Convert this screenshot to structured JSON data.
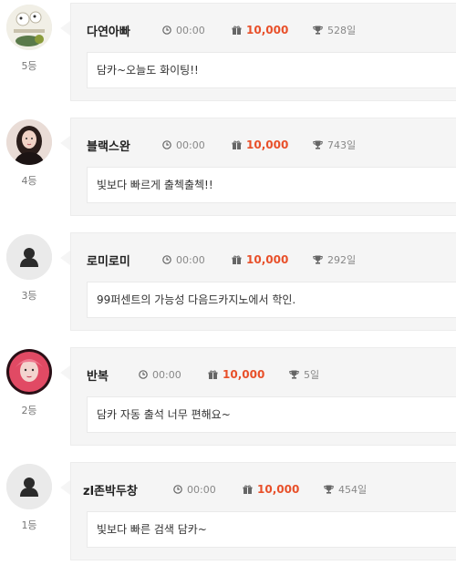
{
  "entries": [
    {
      "rank": "5등",
      "nickname": "다연아빠",
      "time": "00:00",
      "points": "10,000",
      "days": "528일",
      "message": "담카~오늘도 화이팅!!",
      "avatar_icon": "photo-avatar-icon"
    },
    {
      "rank": "4등",
      "nickname": "블랙스완",
      "time": "00:00",
      "points": "10,000",
      "days": "743일",
      "message": "빛보다 빠르게 출첵출첵!!",
      "avatar_icon": "photo-avatar-icon"
    },
    {
      "rank": "3등",
      "nickname": "로미로미",
      "time": "00:00",
      "points": "10,000",
      "days": "292일",
      "message": "99퍼센트의 가능성 다음드카지노에서 학인.",
      "avatar_icon": "default-user-icon"
    },
    {
      "rank": "2등",
      "nickname": "반복",
      "time": "00:00",
      "points": "10,000",
      "days": "5일",
      "message": "담카 자동 출석 너무 편해요~",
      "avatar_icon": "photo-avatar-icon"
    },
    {
      "rank": "1등",
      "nickname": "zl존박두창",
      "time": "00:00",
      "points": "10,000",
      "days": "454일",
      "message": "빛보다 빠른 검색 담카~",
      "avatar_icon": "default-user-icon"
    }
  ],
  "colors": {
    "points": "#e8502a",
    "card_bg": "#f5f5f5",
    "message_bg": "#ffffff"
  }
}
